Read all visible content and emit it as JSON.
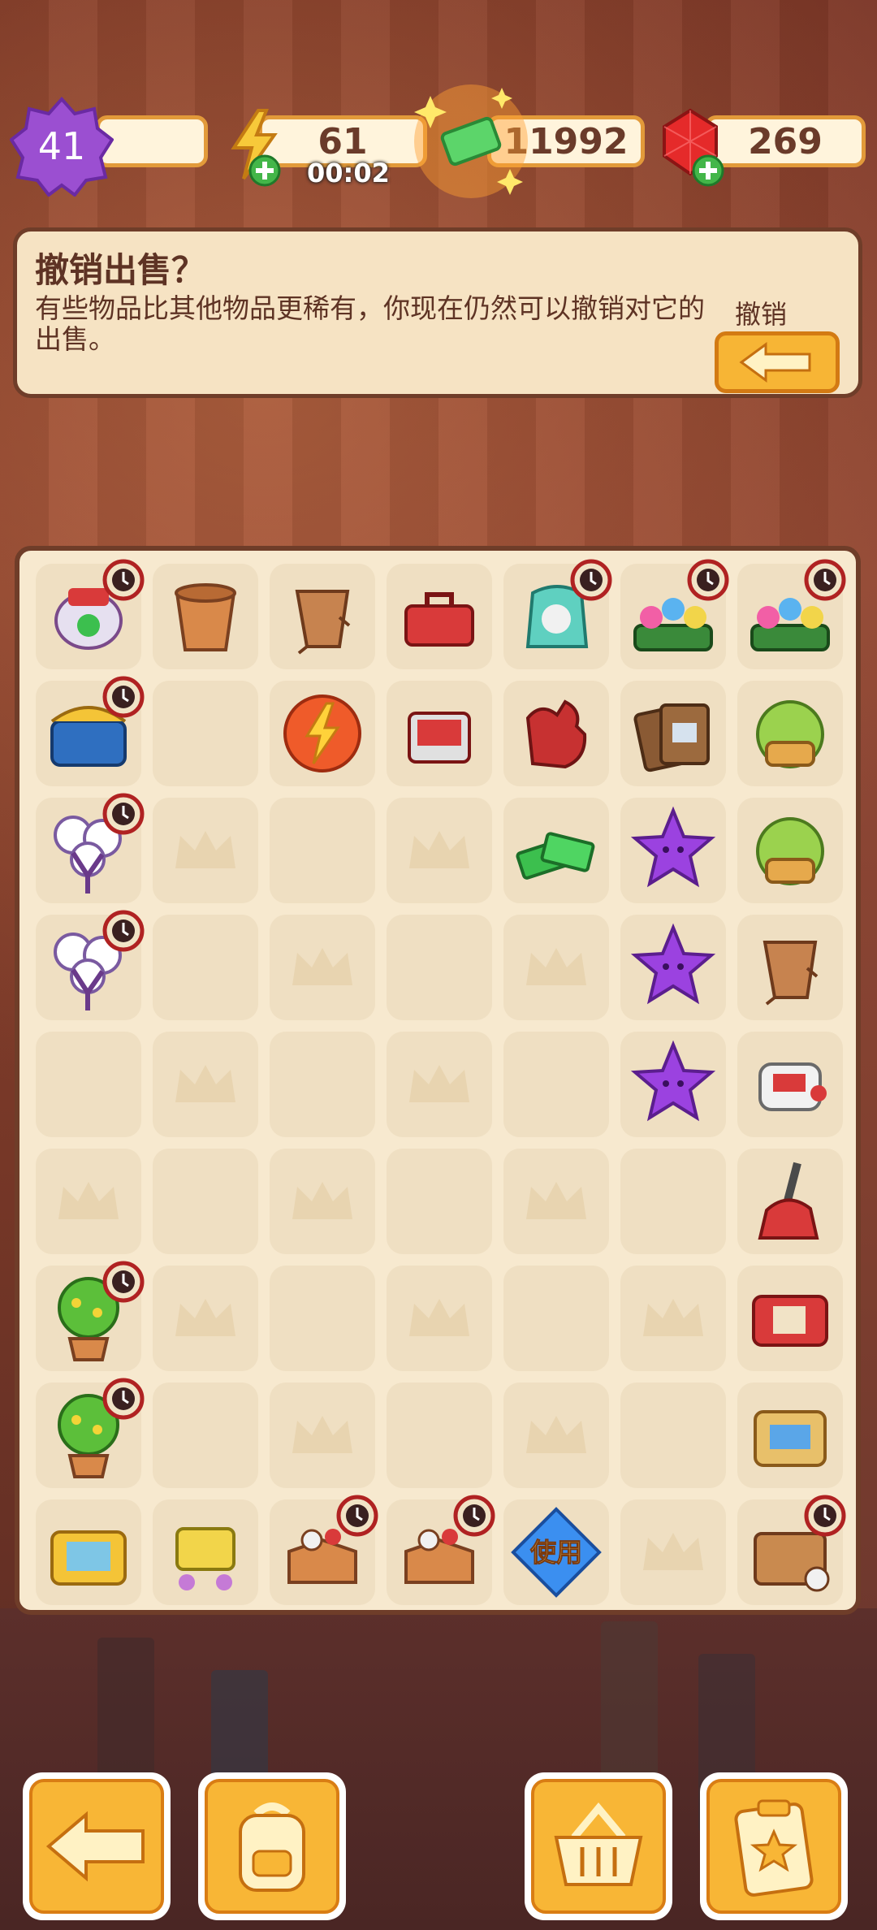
{
  "hud": {
    "level": "41",
    "energy": "61",
    "energy_timer": "00:02",
    "cash": "11992",
    "gems": "269"
  },
  "undo_panel": {
    "title": "撤销出售？",
    "description": "有些物品比其他物品更稀有，你现在仍然可以撤销对它的出售。",
    "undo_label": "撤销"
  },
  "board": {
    "use_label": "使用",
    "items": [
      "lantern-dragon-item",
      "clay-pot-item",
      "broken-pot-item",
      "red-toolbox-item",
      "trash-bag-item",
      "flower-bed-item",
      "flower-bed-item",
      "treasure-chest-item",
      "empty",
      "energy-orb-item",
      "red-box-item",
      "red-gloves-item",
      "cardboard-item",
      "salad-item",
      "cotton-plant-item",
      "crown-slot",
      "empty",
      "crown-slot",
      "cash-stack-item",
      "purple-star-item",
      "salad-item",
      "cotton-plant-item",
      "empty",
      "crown-slot",
      "empty",
      "crown-slot",
      "purple-star-item",
      "broken-pot-item",
      "empty",
      "crown-slot",
      "empty",
      "crown-slot",
      "empty",
      "purple-star-item",
      "robot-toy-item",
      "crown-slot",
      "empty",
      "crown-slot",
      "empty",
      "crown-slot",
      "empty",
      "broom-item",
      "money-tree-item",
      "crown-slot",
      "empty",
      "crown-slot",
      "empty",
      "crown-slot",
      "red-suitcase-item",
      "money-tree-item",
      "empty",
      "crown-slot",
      "empty",
      "crown-slot",
      "empty",
      "gift-case-item",
      "gold-box-item",
      "gift-cart-item",
      "open-box-item",
      "open-box-item",
      "use-booster-item",
      "crown-slot",
      "crate-item"
    ]
  },
  "colors": {
    "accent": "#f8b636",
    "board_bg": "#f7e9cf",
    "panel_bg": "#f6e3c3"
  }
}
